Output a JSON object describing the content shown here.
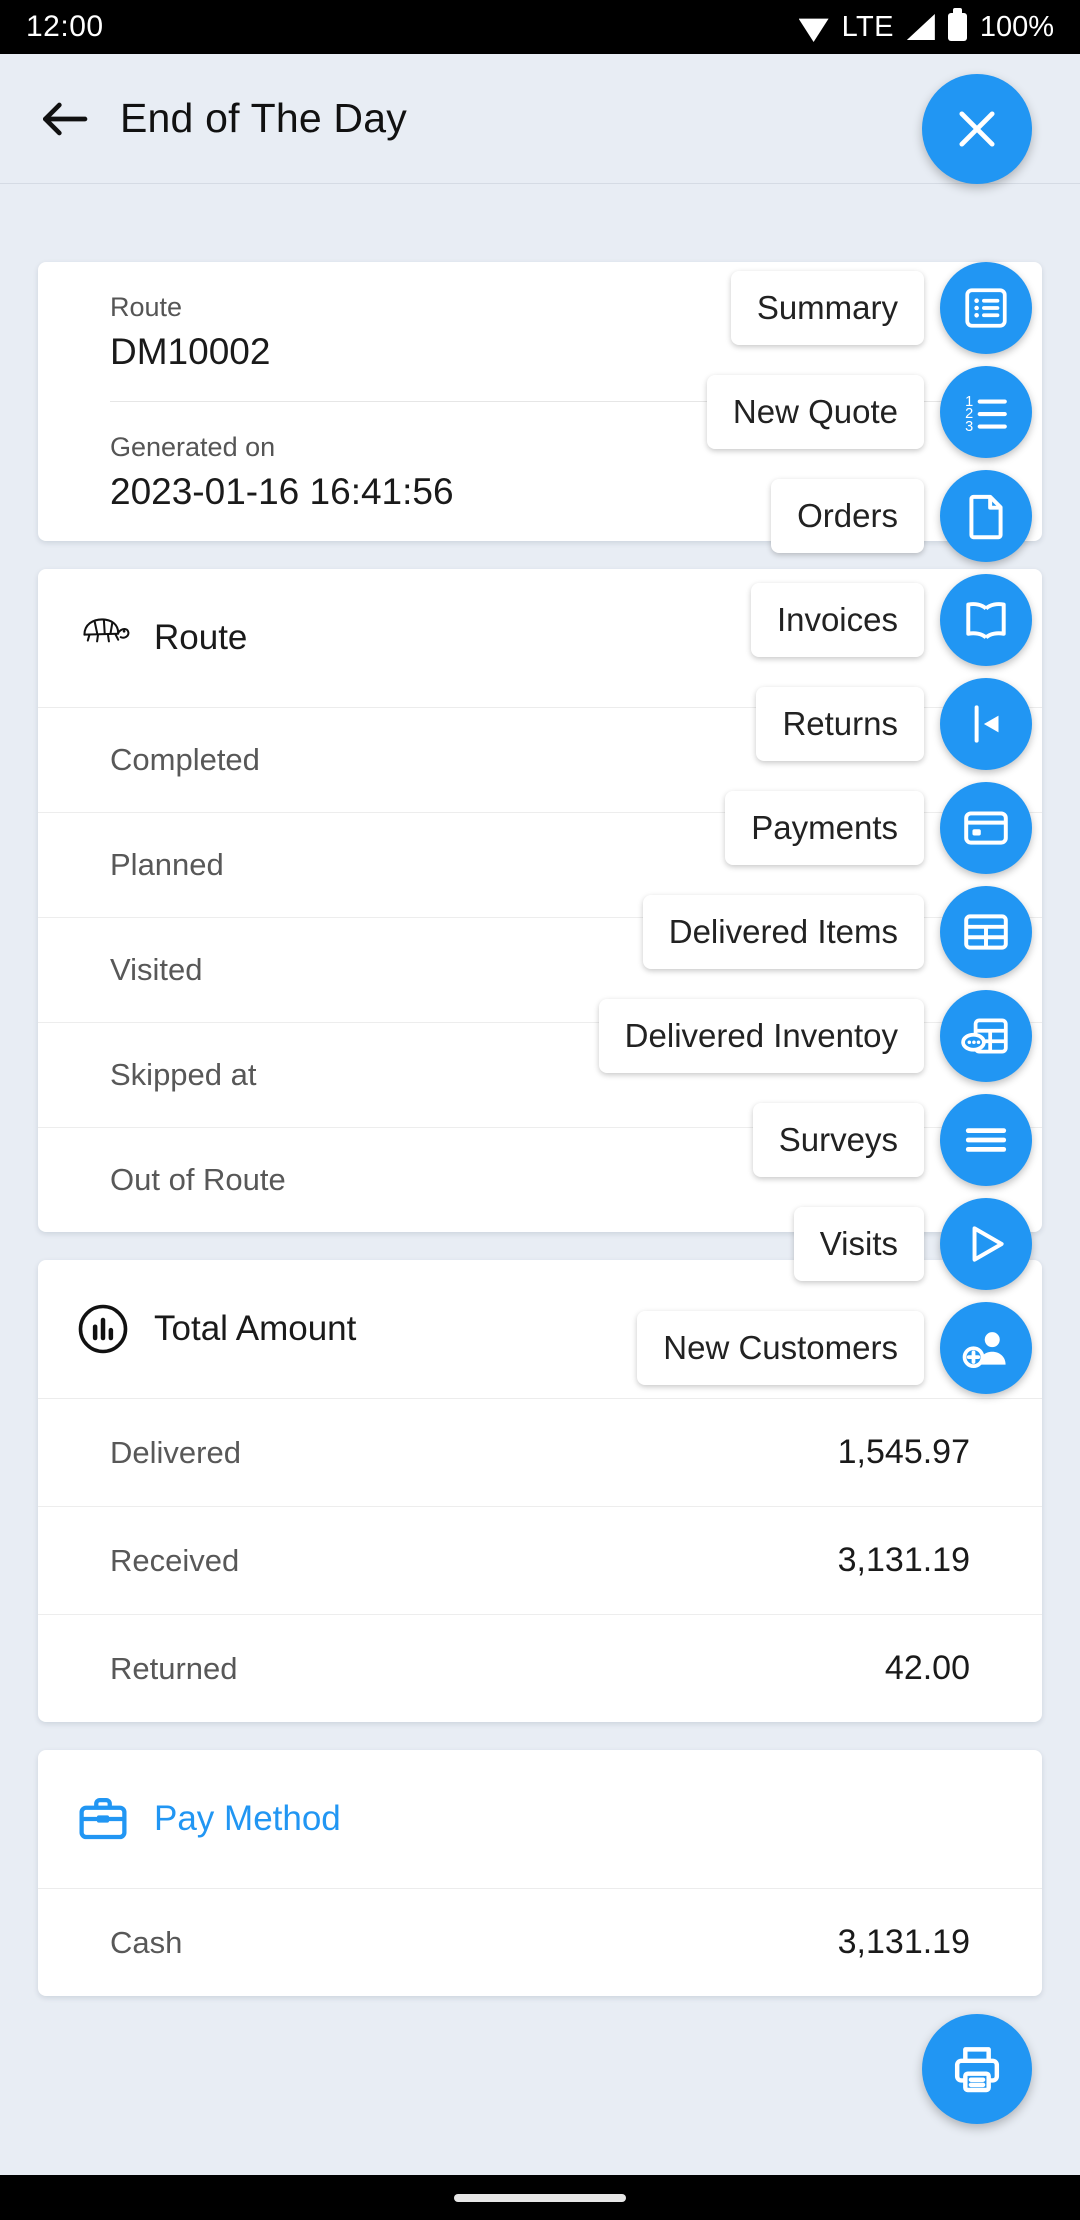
{
  "status_bar": {
    "time": "12:00",
    "network_type": "LTE",
    "battery_text": "100%",
    "icons": [
      "wifi-icon",
      "signal-icon",
      "battery-icon"
    ]
  },
  "app_bar": {
    "back_icon": "back-arrow-icon",
    "title": "End of The Day",
    "close_button": {
      "icon": "close-icon",
      "color": "#2196f3"
    }
  },
  "route_info": {
    "route_label": "Route",
    "route_value": "DM10002",
    "generated_label": "Generated on",
    "generated_value": "2023-01-16 16:41:56"
  },
  "route_section": {
    "icon": "turtle-icon",
    "title": "Route",
    "rows": [
      {
        "label": "Completed",
        "value": ""
      },
      {
        "label": "Planned",
        "value": ""
      },
      {
        "label": "Visited",
        "value": ""
      },
      {
        "label": "Skipped at",
        "value": ""
      },
      {
        "label": "Out of Route",
        "value": ""
      }
    ]
  },
  "total_amount_section": {
    "icon": "bar-chart-icon",
    "title": "Total Amount",
    "rows": [
      {
        "label": "Delivered",
        "value": "1,545.97"
      },
      {
        "label": "Received",
        "value": "3,131.19"
      },
      {
        "label": "Returned",
        "value": "42.00"
      }
    ]
  },
  "pay_method_section": {
    "icon": "briefcase-icon",
    "title": "Pay Method",
    "title_color": "#2196f3",
    "rows": [
      {
        "label": "Cash",
        "value": "3,131.19"
      }
    ]
  },
  "fab_menu": {
    "items": [
      {
        "label": "Summary",
        "icon": "list-box-icon"
      },
      {
        "label": "New Quote",
        "icon": "numbered-list-icon"
      },
      {
        "label": "Orders",
        "icon": "document-icon"
      },
      {
        "label": "Invoices",
        "icon": "book-icon"
      },
      {
        "label": "Returns",
        "icon": "return-arrow-icon"
      },
      {
        "label": "Payments",
        "icon": "credit-card-icon"
      },
      {
        "label": "Delivered Items",
        "icon": "table-icon"
      },
      {
        "label": "Delivered Inventoy",
        "icon": "table-chat-icon"
      },
      {
        "label": "Surveys",
        "icon": "menu-lines-icon"
      },
      {
        "label": "Visits",
        "icon": "play-icon"
      },
      {
        "label": "New Customers",
        "icon": "add-person-icon"
      }
    ]
  },
  "print_fab": {
    "icon": "printer-icon"
  },
  "nav_bar": {
    "handle": "home-indicator"
  },
  "theme": {
    "accent": "#2196f3",
    "page_bg": "#e8edf4",
    "card_bg": "#ffffff"
  }
}
